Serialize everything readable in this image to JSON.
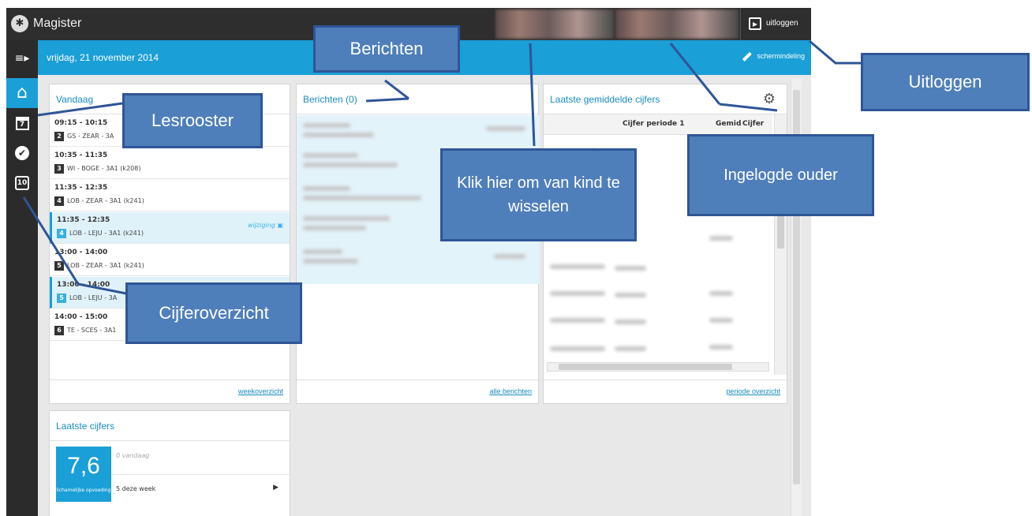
{
  "app": {
    "title": "Magister",
    "logout_label": "uitloggen",
    "date": "vrijdag, 21 november 2014",
    "screen_layout_label": "schermindeling"
  },
  "sidebar": {
    "items": [
      {
        "icon": "menu-icon",
        "glyph": "≡▸"
      },
      {
        "icon": "home-icon",
        "glyph": "⌂"
      },
      {
        "icon": "calendar-icon",
        "glyph": "7"
      },
      {
        "icon": "check-icon",
        "glyph": "✔"
      },
      {
        "icon": "grades-icon",
        "glyph": "10"
      }
    ]
  },
  "today": {
    "title": "Vandaag",
    "lessons": [
      {
        "time": "09:15 - 10:15",
        "hour": "2",
        "desc": "GS - ZEAR - 3A",
        "changed": false
      },
      {
        "time": "10:35 - 11:35",
        "hour": "3",
        "desc": "WI - BOGE - 3A1 (k208)",
        "changed": false
      },
      {
        "time": "11:35 - 12:35",
        "hour": "4",
        "desc": "LOB - ZEAR - 3A1 (k241)",
        "changed": false
      },
      {
        "time": "11:35 - 12:35",
        "hour": "4",
        "desc": "LOB - LEJU - 3A1 (k241)",
        "changed": true,
        "tag": "wijziging"
      },
      {
        "time": "13:00 - 14:00",
        "hour": "5",
        "desc": "LOB - ZEAR - 3A1 (k241)",
        "changed": false
      },
      {
        "time": "13:00 - 14:00",
        "hour": "5",
        "desc": "LOB - LEJU - 3A",
        "changed": true
      },
      {
        "time": "14:00 - 15:00",
        "hour": "6",
        "desc": "TE - SCES - 3A1",
        "changed": false
      }
    ],
    "footer_link": "weekoverzicht"
  },
  "messages": {
    "title": "Berichten (0)",
    "footer_link": "alle berichten"
  },
  "averages": {
    "title": "Laatste gemiddelde cijfers",
    "col1": "Cijfer periode 1",
    "col2": "Gemid",
    "col3": "Cijfer",
    "footer_link": "periode overzicht"
  },
  "latest_grades": {
    "title": "Laatste cijfers",
    "grade": "7,6",
    "subject": "lichamelijke opvoeding",
    "today_text": "0 vandaag",
    "week_text": "5 deze week"
  },
  "callouts": {
    "berichten": "Berichten",
    "lesrooster": "Lesrooster",
    "klik": "Klik hier om van kind te wisselen",
    "ingelogde_ouder": "Ingelogde ouder",
    "uitloggen": "Uitloggen",
    "cijferoverzicht": "Cijferoverzicht"
  },
  "colors": {
    "accent": "#1a9fd6",
    "topbar": "#2e2e2e",
    "callout_fill": "#4f7fba",
    "callout_border": "#2f5596"
  }
}
